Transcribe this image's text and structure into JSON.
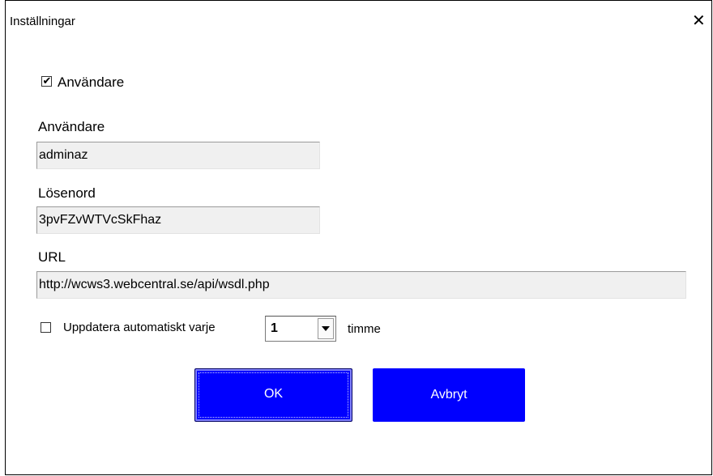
{
  "window": {
    "title": "Inställningar",
    "close_glyph": "✕"
  },
  "user_checkbox": {
    "label": "Användare",
    "checked": true
  },
  "username": {
    "label": "Användare",
    "value": "adminaz"
  },
  "password": {
    "label": "Lösenord",
    "value": "3pvFZvWTVcSkFhaz"
  },
  "url": {
    "label": "URL",
    "value": "http://wcws3.webcentral.se/api/wsdl.php"
  },
  "auto_update": {
    "label": "Uppdatera automatiskt varje",
    "checked": false,
    "interval": "1",
    "unit": "timme"
  },
  "buttons": {
    "ok": "OK",
    "cancel": "Avbryt"
  },
  "colors": {
    "button": "#0000ff",
    "field_bg": "#f0f0f0"
  }
}
